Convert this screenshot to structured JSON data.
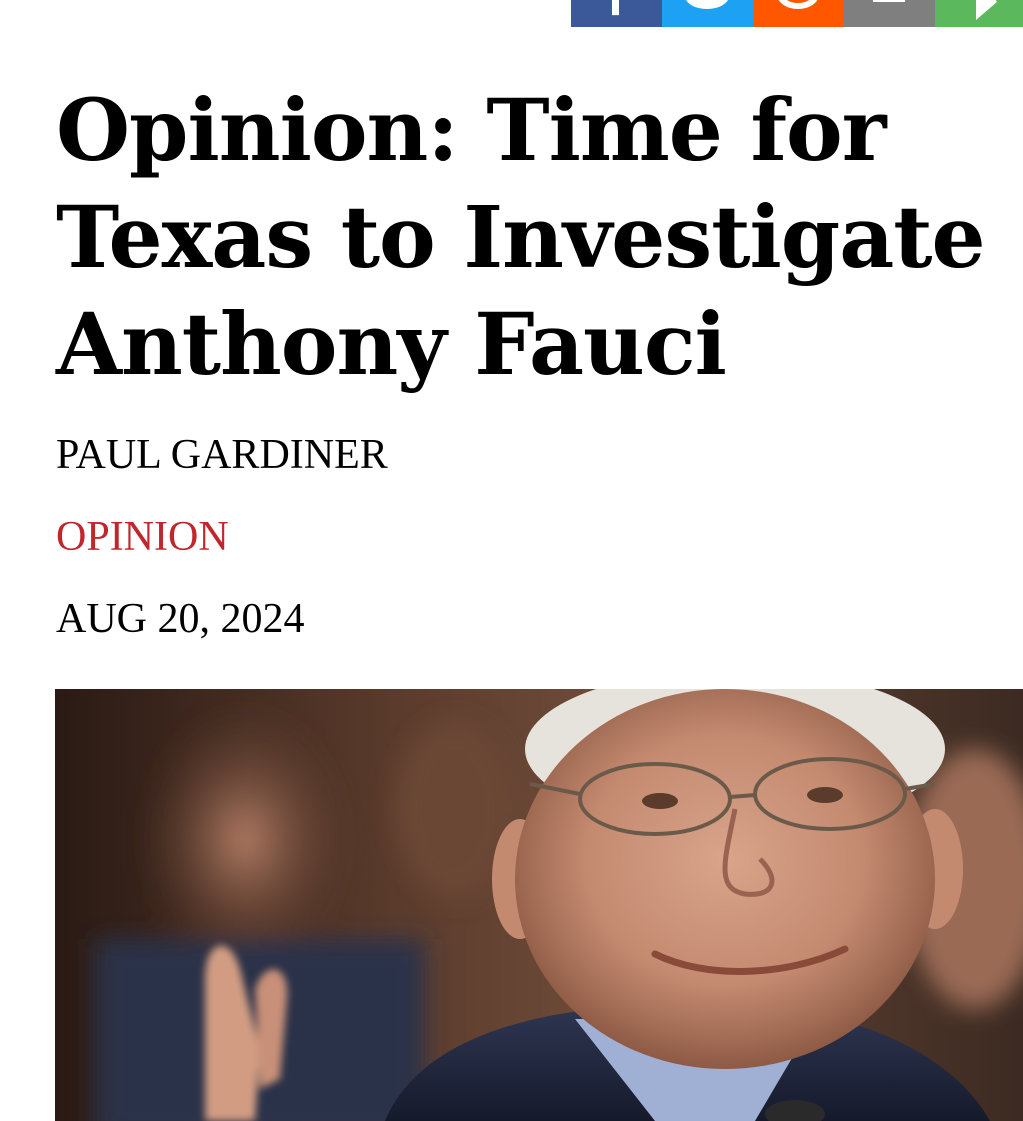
{
  "share_bar": {
    "buttons": [
      {
        "name": "facebook",
        "icon": "facebook-icon",
        "color": "#3b5998"
      },
      {
        "name": "twitter",
        "icon": "twitter-icon",
        "color": "#1da1f2"
      },
      {
        "name": "reddit",
        "icon": "reddit-icon",
        "color": "#ff5700"
      },
      {
        "name": "email",
        "icon": "email-icon",
        "color": "#7f7f7f"
      },
      {
        "name": "share",
        "icon": "share-icon",
        "color": "#5cb85c"
      }
    ]
  },
  "article": {
    "headline": "Opinion: Time for Texas to Investigate Anthony Fauci",
    "author": "PAUL GARDINER",
    "category": "OPINION",
    "date": "AUG 20, 2024",
    "category_color": "#c0272d"
  },
  "hero_image": {
    "description_icon": "photo-image"
  }
}
